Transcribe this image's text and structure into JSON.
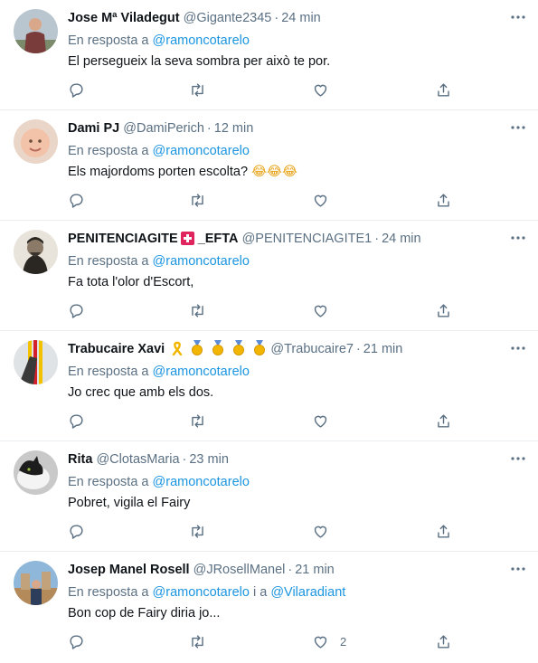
{
  "reply_prefix": "En resposta a",
  "reply_joiner": "i a",
  "tweets": [
    {
      "name": "Jose Mª Viladegut",
      "handle": "@Gigante2345",
      "time": "24 min",
      "reply_to": [
        "@ramoncotarelo"
      ],
      "text": "El persegueix la seva sombra per això te por.",
      "likes": ""
    },
    {
      "name": "Dami PJ",
      "handle": "@DamiPerich",
      "time": "12 min",
      "reply_to": [
        "@ramoncotarelo"
      ],
      "text": "Els majordoms porten escolta?",
      "emojis": "😂😂😂",
      "likes": ""
    },
    {
      "name": "PENITENCIAGITE",
      "name_suffix": "_EFTA",
      "handle": "@PENITENCIAGITE1",
      "time": "24 min",
      "reply_to": [
        "@ramoncotarelo"
      ],
      "text": "Fa tota l'olor d'Escort,",
      "likes": ""
    },
    {
      "name": "Trabucaire Xavi",
      "handle": "@Trabucaire7",
      "time": "21 min",
      "reply_to": [
        "@ramoncotarelo"
      ],
      "text": "Jo crec que amb els dos.",
      "likes": ""
    },
    {
      "name": "Rita",
      "handle": "@ClotasMaria",
      "time": "23 min",
      "reply_to": [
        "@ramoncotarelo"
      ],
      "text": "Pobret, vigila el Fairy",
      "likes": ""
    },
    {
      "name": "Josep Manel Rosell",
      "handle": "@JRosellManel",
      "time": "21 min",
      "reply_to": [
        "@ramoncotarelo",
        "@Vilaradiant"
      ],
      "text": "Bon cop de Fairy diria jo...",
      "likes": "2"
    }
  ],
  "colors": {
    "text": "#0f1419",
    "secondary": "#5b7083",
    "link": "#1b95e0",
    "divider": "#ebeef0"
  },
  "icons": {
    "reply": "reply-icon",
    "retweet": "retweet-icon",
    "like": "like-icon",
    "share": "share-icon",
    "more": "more-icon"
  }
}
